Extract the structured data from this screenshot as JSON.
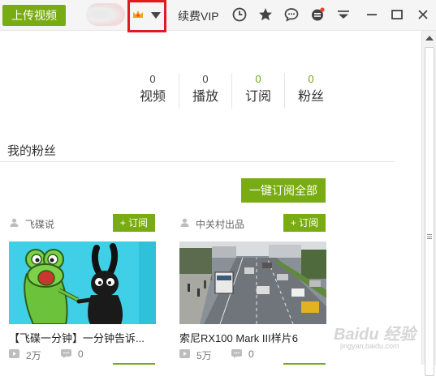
{
  "toolbar": {
    "upload_label": "上传视频",
    "vip_label": "续费VIP",
    "icons": [
      "clock-icon",
      "star-icon",
      "chat-icon",
      "notification-icon",
      "menu-icon",
      "minimize-icon",
      "maximize-icon",
      "close-icon"
    ],
    "accent_color": "#79ac12",
    "highlight_color": "#e01a22"
  },
  "stats": [
    {
      "value": "0",
      "label": "视频"
    },
    {
      "value": "0",
      "label": "播放"
    },
    {
      "value": "0",
      "label": "订阅"
    },
    {
      "value": "0",
      "label": "粉丝"
    }
  ],
  "fans": {
    "section_title": "我的粉丝",
    "subscribe_all_label": "一键订阅全部",
    "cards": [
      {
        "user": "飞碟说",
        "subscribe_label": "+ 订阅",
        "title": "【飞碟一分钟】一分钟告诉...",
        "plays": "2万",
        "comments": "0"
      },
      {
        "user": "中关村出品",
        "subscribe_label": "+ 订阅",
        "title": "索尼RX100 Mark III样片6",
        "plays": "5万",
        "comments": "0"
      }
    ]
  },
  "watermark": {
    "brand": "Baidu 经验",
    "url": "jingyan.baidu.com"
  }
}
